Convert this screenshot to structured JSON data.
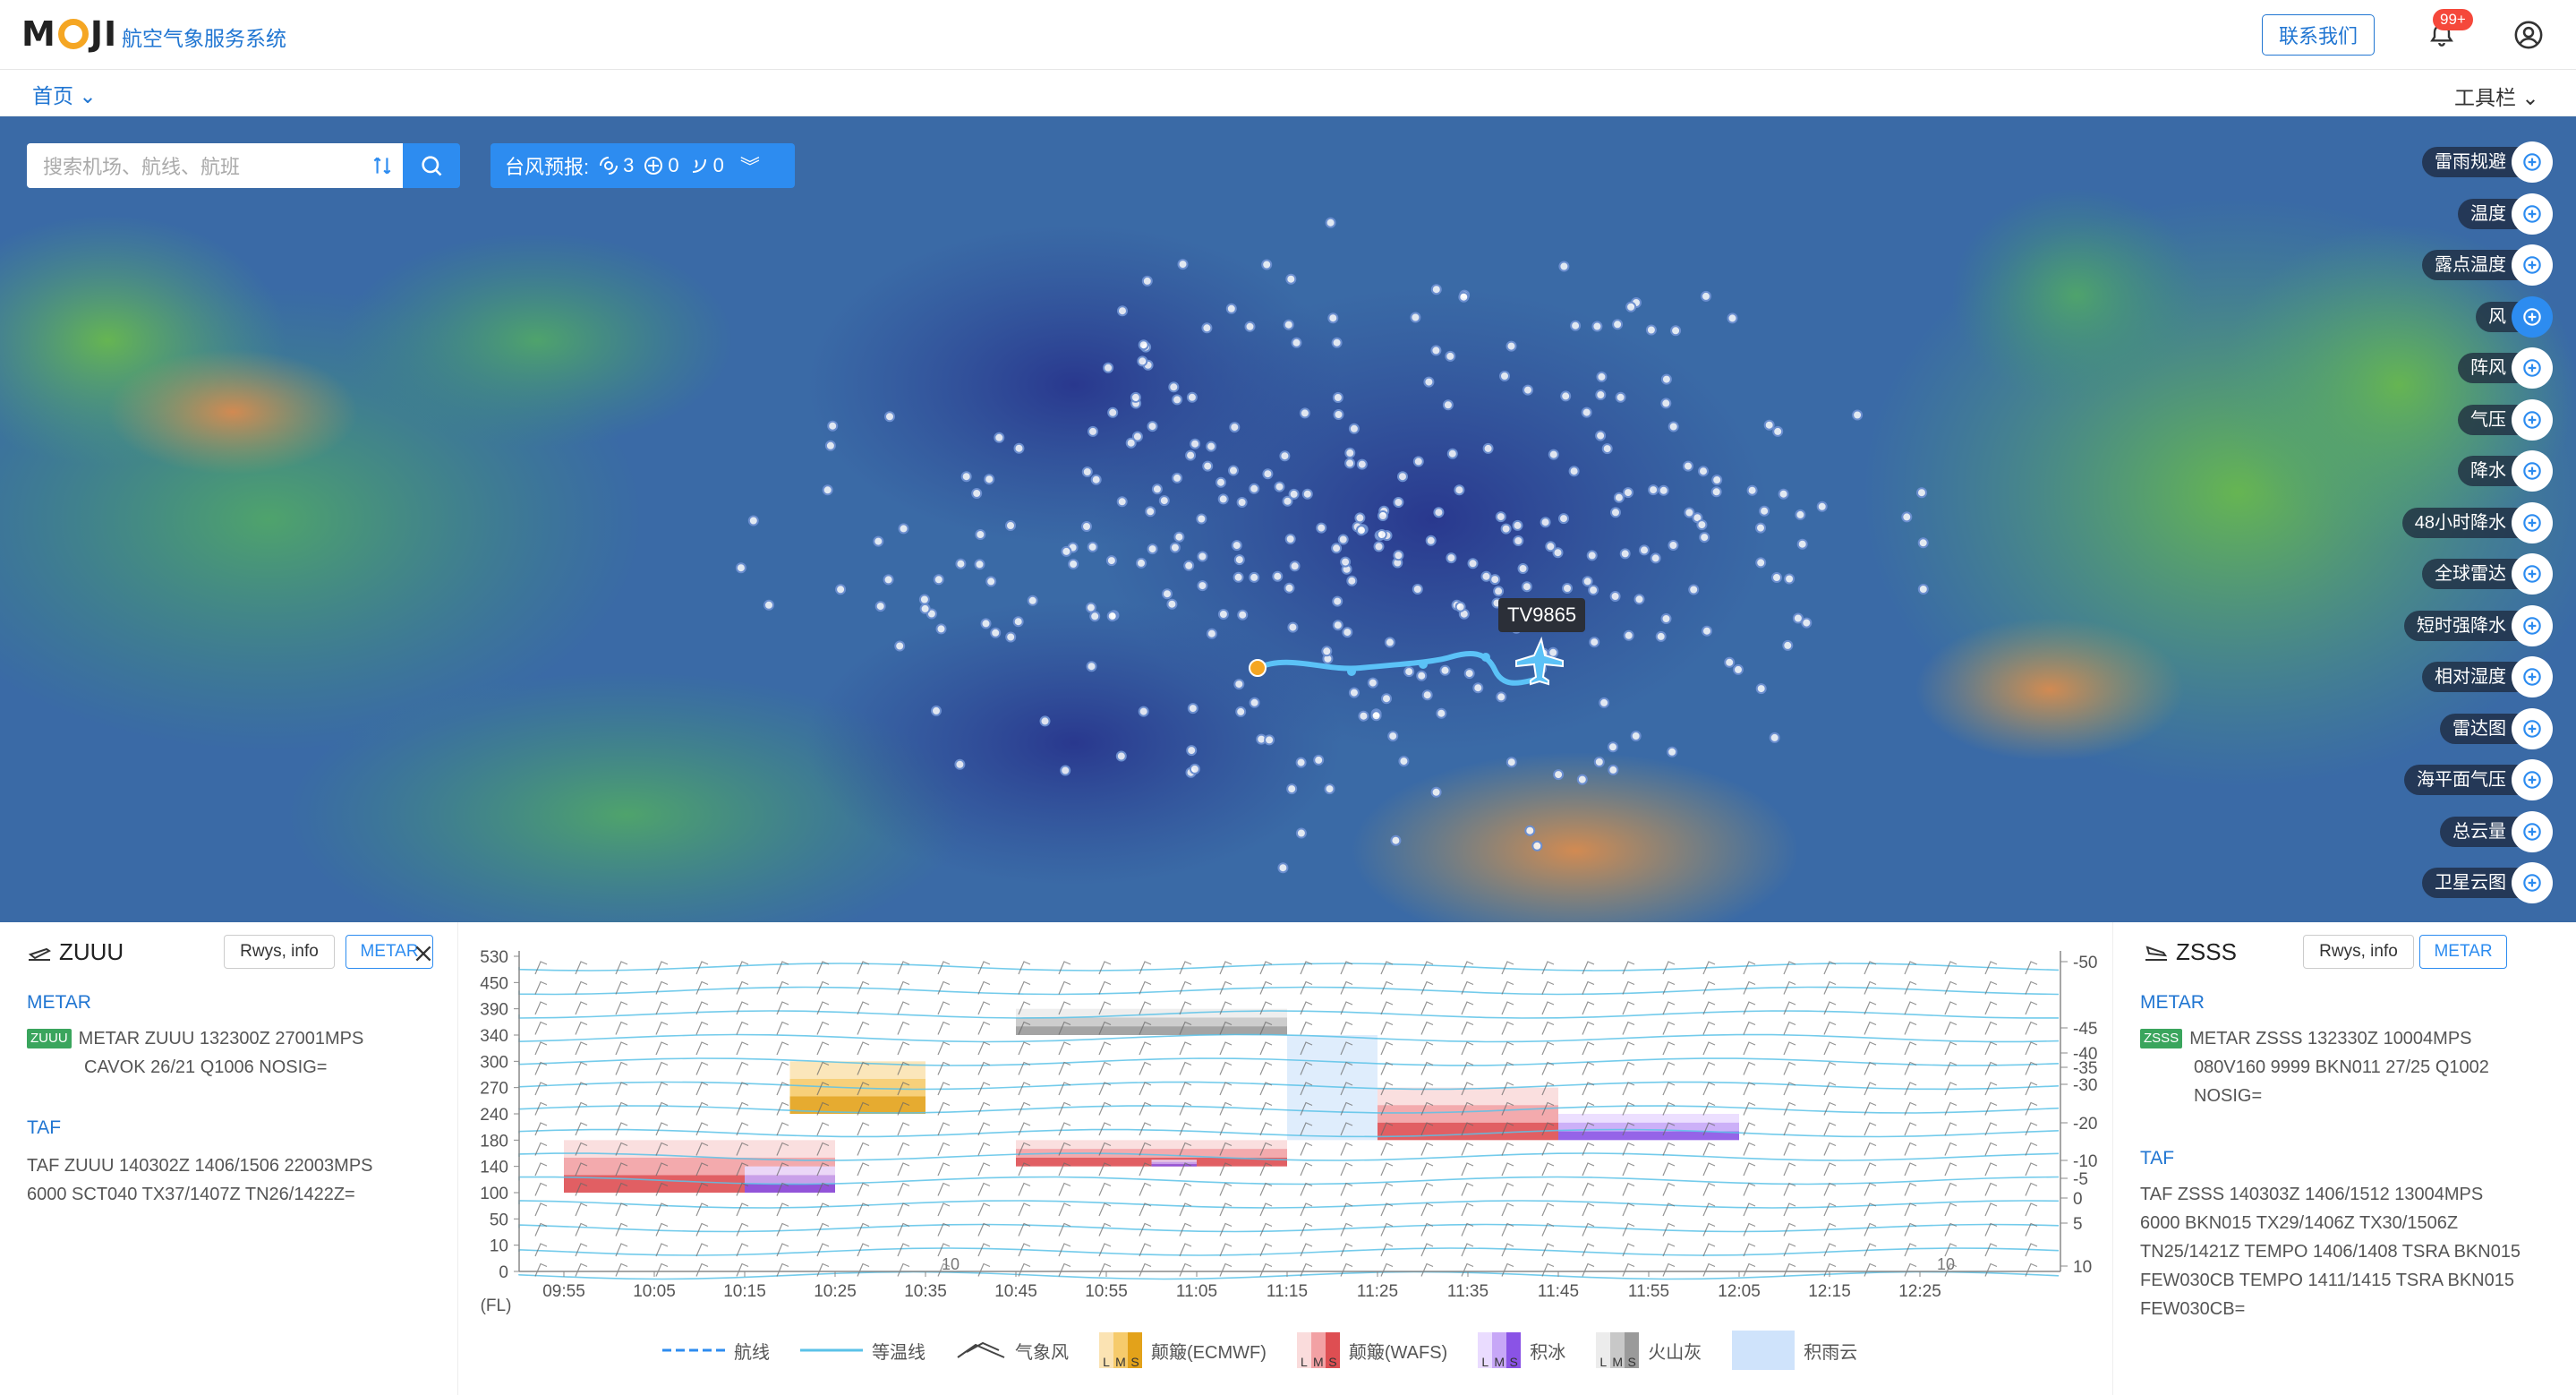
{
  "header": {
    "logo_text_a": "M",
    "logo_text_b": "JI",
    "app_title": "航空气象服务系统",
    "contact_label": "联系我们",
    "notification_badge": "99+",
    "icons": {
      "bell": "bell-icon",
      "user": "user-icon"
    }
  },
  "nav": {
    "home_label": "首页",
    "tools_label": "工具栏"
  },
  "search": {
    "placeholder": "搜索机场、航线、航班"
  },
  "typhoon": {
    "label": "台风预报:",
    "count_a": "3",
    "count_b": "0",
    "count_c": "0"
  },
  "flight": {
    "id": "TV9865"
  },
  "layers": [
    {
      "label": "雷雨规避",
      "icon": "thunderstorm-icon",
      "active": false
    },
    {
      "label": "温度",
      "icon": "thermometer-icon",
      "active": false
    },
    {
      "label": "露点温度",
      "icon": "dewpoint-icon",
      "active": false
    },
    {
      "label": "风",
      "icon": "wind-icon",
      "active": true
    },
    {
      "label": "阵风",
      "icon": "gust-icon",
      "active": false
    },
    {
      "label": "气压",
      "icon": "pressure-icon",
      "active": false
    },
    {
      "label": "降水",
      "icon": "precipitation-icon",
      "active": false
    },
    {
      "label": "48小时降水",
      "icon": "precip-48h-icon",
      "active": false
    },
    {
      "label": "全球雷达",
      "icon": "global-radar-icon",
      "active": false
    },
    {
      "label": "短时强降水",
      "icon": "heavy-rain-icon",
      "active": false
    },
    {
      "label": "相对湿度",
      "icon": "humidity-icon",
      "active": false
    },
    {
      "label": "雷达图",
      "icon": "radar-icon",
      "active": false
    },
    {
      "label": "海平面气压",
      "icon": "sea-pressure-icon",
      "active": false
    },
    {
      "label": "总云量",
      "icon": "cloud-icon",
      "active": false
    },
    {
      "label": "卫星云图",
      "icon": "satellite-icon",
      "active": false
    }
  ],
  "left_panel": {
    "airport": "ZUUU",
    "rwys_label": "Rwys, info",
    "metar_btn": "METAR",
    "metar_title": "METAR",
    "metar_tag": "ZUUU",
    "metar_line1": "METAR ZUUU 132300Z 27001MPS",
    "metar_line2": "CAVOK 26/21 Q1006 NOSIG=",
    "taf_title": "TAF",
    "taf_line1": "TAF ZUUU 140302Z 1406/1506 22003MPS",
    "taf_line2": "6000 SCT040 TX37/1407Z TN26/1422Z="
  },
  "right_panel": {
    "airport": "ZSSS",
    "rwys_label": "Rwys, info",
    "metar_btn": "METAR",
    "metar_title": "METAR",
    "metar_tag": "ZSSS",
    "metar_line1": "METAR ZSSS 132330Z 10004MPS",
    "metar_line2": "080V160 9999 BKN011 27/25 Q1002",
    "metar_line3": "NOSIG=",
    "taf_title": "TAF",
    "taf_line1": "TAF ZSSS 140303Z 1406/1512 13004MPS",
    "taf_line2": "6000 BKN015 TX29/1406Z TX30/1506Z",
    "taf_line3": "TN25/1421Z TEMPO 1406/1408 TSRA BKN015",
    "taf_line4": "FEW030CB TEMPO 1411/1415 TSRA BKN015",
    "taf_line5": "FEW030CB="
  },
  "chart_data": {
    "type": "area",
    "y_unit_label": "(FL)",
    "y_ticks": [
      0,
      10,
      50,
      100,
      140,
      180,
      240,
      270,
      300,
      340,
      390,
      450,
      530
    ],
    "x_ticks": [
      "09:55",
      "10:05",
      "10:15",
      "10:25",
      "10:35",
      "10:45",
      "10:55",
      "11:05",
      "11:15",
      "11:25",
      "11:35",
      "11:45",
      "11:55",
      "12:05",
      "12:15",
      "12:25"
    ],
    "temp_labels": [
      "-50",
      "-45",
      "-40",
      "-35",
      "-30",
      "-20",
      "-10",
      "-5",
      "0",
      "5",
      "10"
    ],
    "isotherm_inline_labels": [
      "10",
      "10"
    ],
    "bands": [
      {
        "kind": "ecmwf",
        "x0": "10:20",
        "x1": "10:35",
        "lo": 240,
        "hi": 300
      },
      {
        "kind": "wafs",
        "x0": "09:55",
        "x1": "10:25",
        "lo": 100,
        "hi": 180
      },
      {
        "kind": "icing",
        "x0": "10:15",
        "x1": "10:25",
        "lo": 100,
        "hi": 140
      },
      {
        "kind": "ash",
        "x0": "10:45",
        "x1": "11:15",
        "lo": 340,
        "hi": 390
      },
      {
        "kind": "wafs",
        "x0": "10:45",
        "x1": "11:15",
        "lo": 140,
        "hi": 180
      },
      {
        "kind": "icing",
        "x0": "11:00",
        "x1": "11:05",
        "lo": 140,
        "hi": 150
      },
      {
        "kind": "cb",
        "x0": "11:15",
        "x1": "11:25",
        "lo": 180,
        "hi": 340
      },
      {
        "kind": "wafs",
        "x0": "11:25",
        "x1": "11:45",
        "lo": 180,
        "hi": 270
      },
      {
        "kind": "icing",
        "x0": "11:45",
        "x1": "12:05",
        "lo": 180,
        "hi": 240
      }
    ],
    "legend": [
      {
        "name": "航线",
        "style": "dashed"
      },
      {
        "name": "等温线",
        "style": "line"
      },
      {
        "name": "气象风",
        "style": "barb"
      },
      {
        "name": "颠簸(ECMWF)",
        "style": "swatch",
        "colors": [
          "#fbe3b3",
          "#f6cb6c",
          "#e3a21a"
        ]
      },
      {
        "name": "颠簸(WAFS)",
        "style": "swatch",
        "colors": [
          "#fadcdc",
          "#f2a1a4",
          "#de4e52"
        ]
      },
      {
        "name": "积冰",
        "style": "swatch",
        "colors": [
          "#eadcff",
          "#c7a7f7",
          "#8a53e6"
        ]
      },
      {
        "name": "火山灰",
        "style": "swatch",
        "colors": [
          "#ececec",
          "#c8c8c8",
          "#9a9a9a"
        ]
      },
      {
        "name": "积雨云",
        "style": "solid",
        "colors": [
          "#cfe3fb"
        ]
      }
    ],
    "swatch_letters": [
      "L",
      "M",
      "S"
    ]
  },
  "colors": {
    "accent": "#2d8cf0",
    "brand_blue": "#2176d2",
    "badge": "#f5483b",
    "metar_tag": "#3aa55d"
  }
}
